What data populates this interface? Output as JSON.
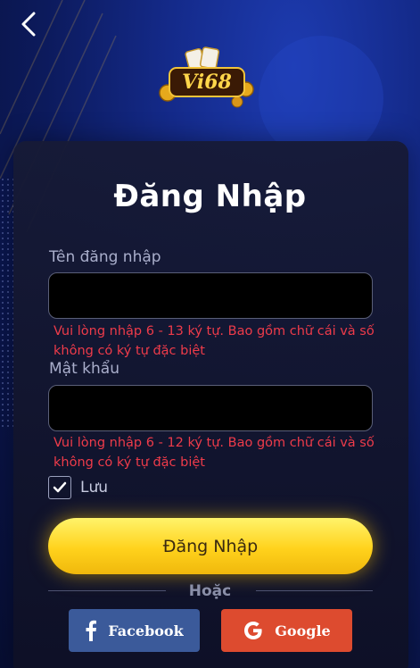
{
  "header": {
    "back_icon": "chevron-left-icon",
    "logo_text": "Vi68"
  },
  "login": {
    "title": "Đăng Nhập",
    "username_label": "Tên đăng nhập",
    "username_value": "",
    "username_hint": "Vui lòng nhập 6 - 13 ký tự. Bao gồm chữ cái và số không có ký tự đặc biệt",
    "password_label": "Mật khẩu",
    "password_value": "",
    "password_hint": "Vui lòng nhập 6 - 12 ký tự. Bao gồm chữ cái và số không có ký tự đặc biệt",
    "remember_label": "Lưu",
    "remember_checked": true,
    "submit_label": "Đăng Nhập",
    "or_text": "Hoặc"
  },
  "social": {
    "facebook_label": "Facebook",
    "google_label": "Google"
  },
  "colors": {
    "accent_yellow": "#ffd21c",
    "error_red": "#ee3b4a",
    "facebook_blue": "#3b5a9a",
    "google_red": "#dd4b2f"
  }
}
